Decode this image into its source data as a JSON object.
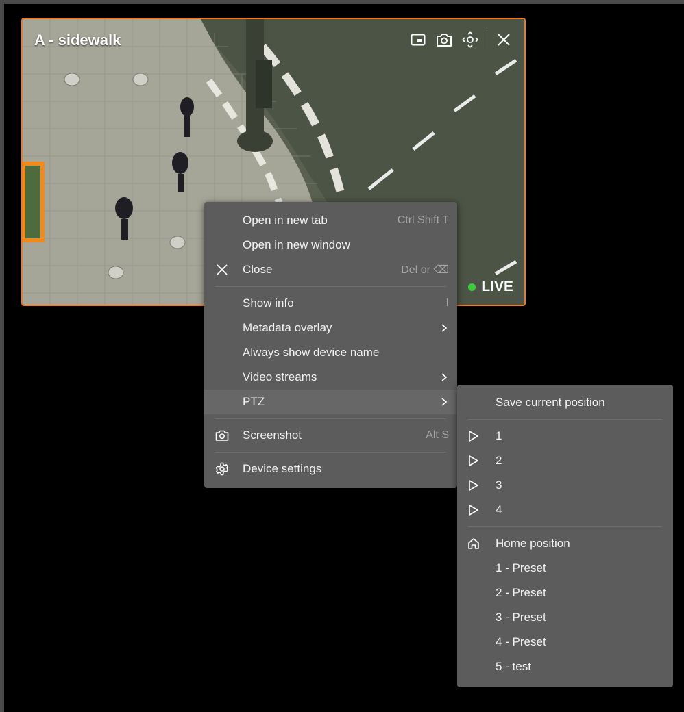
{
  "tile": {
    "title": "A - sidewalk",
    "live_label": "LIVE",
    "tools": [
      "picture-in-picture-icon",
      "screenshot-icon",
      "ptz-move-icon",
      "close-icon"
    ],
    "accent": "#f07a1c",
    "live_color": "#3ccb3c"
  },
  "context_menu": {
    "open_new_tab": "Open in new tab",
    "open_new_tab_shortcut": "Ctrl Shift T",
    "open_new_window": "Open in new window",
    "close": "Close",
    "close_shortcut": "Del or ⌫",
    "show_info": "Show info",
    "show_info_shortcut": "I",
    "metadata_overlay": "Metadata overlay",
    "always_show_device_name": "Always show device name",
    "video_streams": "Video streams",
    "ptz": "PTZ",
    "screenshot": "Screenshot",
    "screenshot_shortcut": "Alt S",
    "device_settings": "Device settings"
  },
  "ptz_menu": {
    "save_current_position": "Save current position",
    "tours": [
      "1",
      "2",
      "3",
      "4"
    ],
    "home_position": "Home position",
    "presets": [
      "1 - Preset",
      "2 - Preset",
      "3 - Preset",
      "4 - Preset",
      "5 - test"
    ]
  }
}
